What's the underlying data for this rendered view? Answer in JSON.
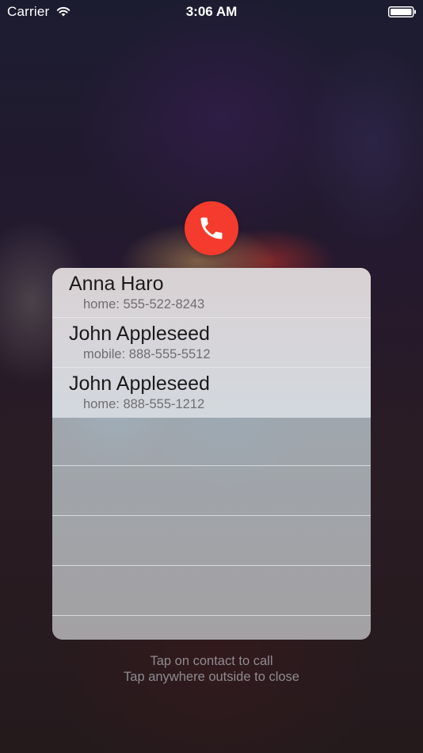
{
  "status_bar": {
    "carrier": "Carrier",
    "time": "3:06 AM",
    "icons": [
      "wifi-icon",
      "battery-icon"
    ]
  },
  "call_button": {
    "icon": "phone-icon",
    "color": "#f53b2d"
  },
  "contacts": [
    {
      "name": "Anna Haro",
      "phone": "home: 555-522-8243"
    },
    {
      "name": "John Appleseed",
      "phone": "mobile: 888-555-5512"
    },
    {
      "name": "John Appleseed",
      "phone": "home: 888-555-1212"
    }
  ],
  "hints": {
    "call": "Tap on contact to call",
    "close": "Tap anywhere outside to close"
  }
}
